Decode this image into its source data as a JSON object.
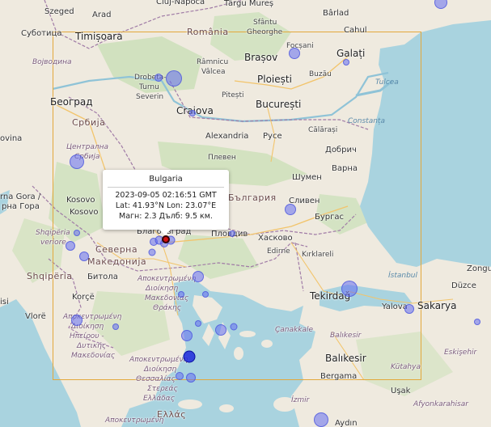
{
  "popup": {
    "title": "Bulgaria",
    "datetime": "2023-09-05 02:16:51 GMT",
    "coords": "Lat: 41.93°N Lon: 23.07°E",
    "magnitude": "Магн: 2.3 Дълб: 9.5 км."
  },
  "colors": {
    "sea": "#a9d3df",
    "land": "#efeadf",
    "bbox": "#e3a83b",
    "quake_small": "#6e78f0",
    "quake_strong": "#1e28dc",
    "quake_selected": "#d01010"
  },
  "labels": {
    "szeged": "Szeged",
    "arad": "Arad",
    "cluj": "Cluj-Napoca",
    "targu_mures": "Târgu Mureș",
    "barlad": "Bârlad",
    "sfantu": "Sfântu",
    "gheorghe": "Gheorghe",
    "suceava_cahul": "Cahul",
    "subotica": "Суботица",
    "timisoara": "Timișoara",
    "romania": "România",
    "focsani": "Focșani",
    "galati": "Galați",
    "vojvodina": "Војводина",
    "ramnicu": "Râmnicu",
    "valcea": "Vâlcea",
    "brasov": "Brașov",
    "drobeta": "Drobeta-",
    "turnu": "Turnu",
    "severin": "Severin",
    "ploiesti": "Ploiești",
    "buzau": "Buzău",
    "tulcea": "Tulcea",
    "beograd": "Београд",
    "pitesti": "Pitești",
    "bucuresti": "București",
    "srbija": "Србија",
    "craiova": "Craiova",
    "constanta": "Constanța",
    "calarasi": "Călărași",
    "ovina": "ovina",
    "centralna": "Централна",
    "srbija2": "Србија",
    "alexandria": "Alexandria",
    "ruse": "Русе",
    "dobrich": "Добрич",
    "pleven": "Плевен",
    "shumen": "Шумен",
    "varna": "Варна",
    "bulgaria": "България",
    "sliven": "Сливен",
    "rna_gora": "rna Gora /",
    "rna_gora2": "рна Гора",
    "kosovo": "Kosovo",
    "kosovo2": "Kosovo",
    "burgas": "Бургас",
    "plovdiv": "Пловдив",
    "haskovo": "Хасково",
    "shqiperia_region": "Shqipëria",
    "verore": "veriore",
    "severna": "Северна",
    "makedonija": "Македонија",
    "edirne": "Edirne",
    "kirklareli": "Kırklareli",
    "zongu": "Zongu",
    "shqiperia": "Shqipëria",
    "bitola": "Битола",
    "ap_makedonia": "Αποκεντρωμένη",
    "dioikisi": "Διοίκηση",
    "makedonias": "Μακεδονίας",
    "thrakis": "Θράκης",
    "istanbul": "İstanbul",
    "duzce": "Düzce",
    "korce": "Korçë",
    "isi": "isi",
    "tekirdag": "Tekirdağ",
    "yalova": "Yalova",
    "sakarya": "Sakarya",
    "vlore": "Vlorë",
    "ap_ipeirou": "Αποκεντρωμένη",
    "dioikisi2": "Διοίκηση",
    "ipeirou": "Ηπείρου -",
    "dytikis": "Δυτικής",
    "makedonias2": "Μακεδονίας",
    "canakkale": "Çanakkale",
    "balikesir_region": "Balıkesir",
    "eskisehir": "Eskişehir",
    "ap_thessalias": "Αποκεντρωμένη",
    "dioikisi3": "Διοίκηση",
    "thessalias": "Θεσσαλίας -",
    "stereas": "Στερεάς",
    "elladas": "Ελλάδας",
    "balikesir": "Balıkesir",
    "kutahya": "Kütahya",
    "bergama": "Bergama",
    "usak": "Uşak",
    "izmir": "İzmir",
    "afyon": "Afyonkarahisar",
    "ellas": "Ελλάς",
    "ap_bottom": "Αποκεντρωμένη",
    "aydin": "Aydın",
    "blagoevgrad": "Благоевград"
  },
  "quake_count": 34
}
